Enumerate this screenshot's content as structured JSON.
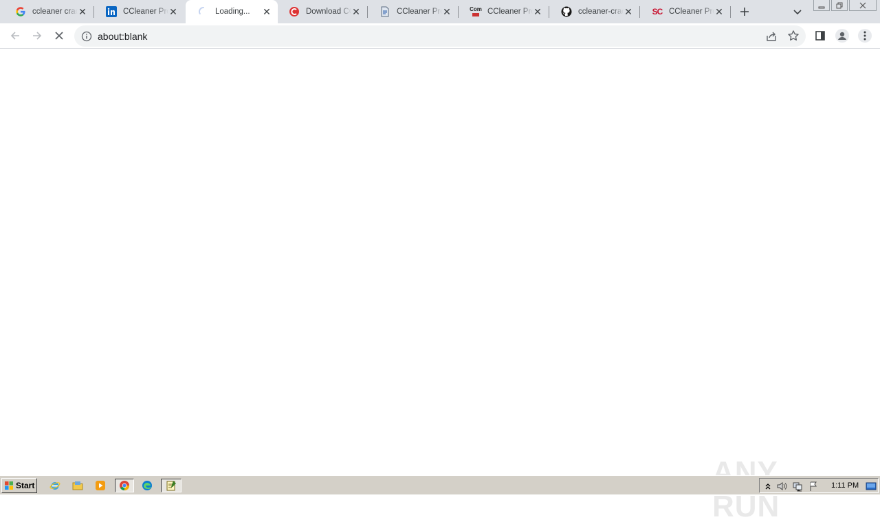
{
  "browser": {
    "tabs": [
      {
        "title": "ccleaner crack",
        "icon": "google-g-icon",
        "active": false
      },
      {
        "title": "CCleaner Prof",
        "icon": "linkedin-icon",
        "active": false
      },
      {
        "title": "Loading...",
        "icon": "loading-spinner-icon",
        "active": true
      },
      {
        "title": "Download CCl",
        "icon": "ccleaner-icon",
        "active": false
      },
      {
        "title": "CCleaner Prof",
        "icon": "document-icon",
        "active": false
      },
      {
        "title": "CCleaner Pro",
        "icon": "com-icon",
        "active": false
      },
      {
        "title": "ccleaner-crack",
        "icon": "github-icon",
        "active": false
      },
      {
        "title": "CCleaner Prof",
        "icon": "sc-icon",
        "active": false
      }
    ],
    "address": {
      "url": "about:blank"
    },
    "favicon_texts": {
      "sc": "SC",
      "com": "Com"
    }
  },
  "watermark": {
    "text": "ANY RUN"
  },
  "taskbar": {
    "start_label": "Start",
    "clock": "1:11 PM"
  },
  "colors": {
    "tabstrip": "#dee1e6",
    "omnibox": "#f1f3f4",
    "taskbar": "#d4d0c8"
  }
}
